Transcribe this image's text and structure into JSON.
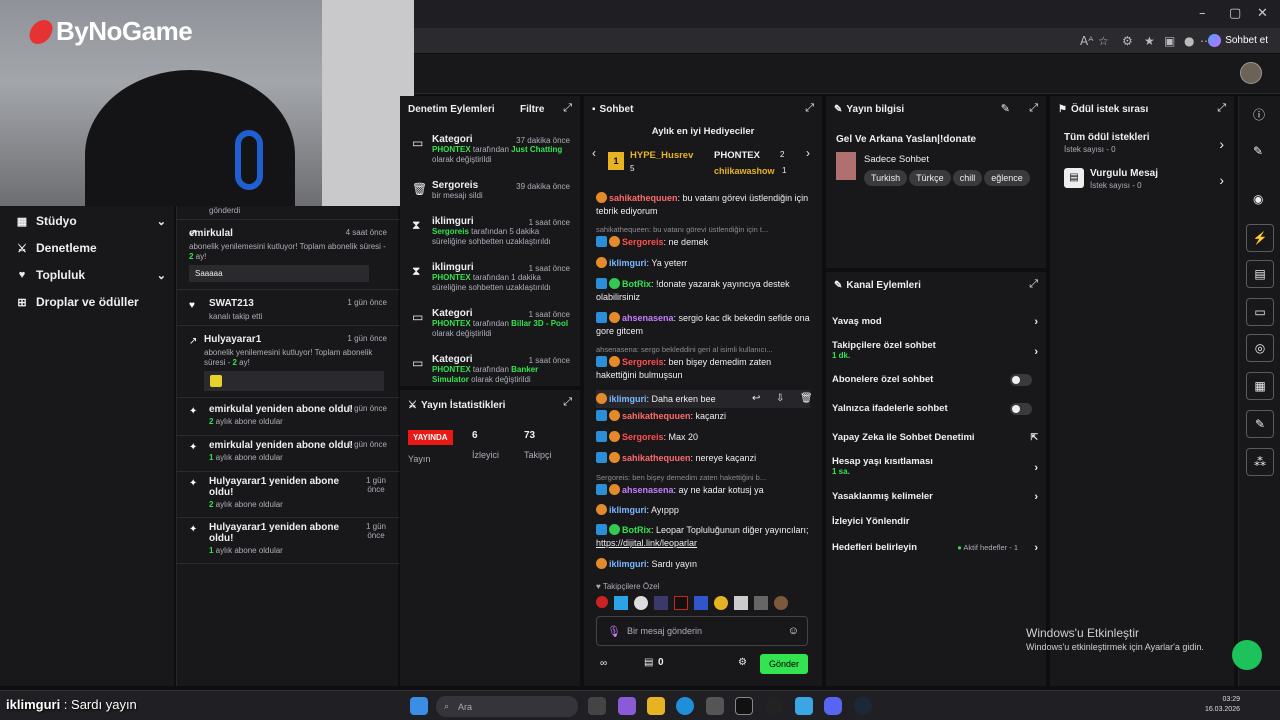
{
  "browser": {
    "sohbet_et": "Sohbet et",
    "reader": "Aᴬ"
  },
  "webcam": {
    "logo": "ByNoGame"
  },
  "leftnav": {
    "items": [
      {
        "label": "Stüdyo"
      },
      {
        "label": "Denetleme"
      },
      {
        "label": "Topluluk"
      },
      {
        "label": "Droplar ve ödüller"
      }
    ]
  },
  "activity": {
    "top_fragment": "gönderdi",
    "items": [
      {
        "name": "emirkulal",
        "time": "4 saat önce",
        "sub": "abonelik yenilemesini kutluyor! Toplam abonelik süresi - ",
        "months": "2",
        "sub_end": " ay!",
        "msg": "Saaaaa"
      },
      {
        "name": "SWAT213",
        "time": "1 gün önce",
        "sub": "kanalı takip etti"
      },
      {
        "name": "Hulyayarar1",
        "time": "1 gün önce",
        "sub": "abonelik yenilemesini kutluyor! Toplam abonelik süresi - ",
        "months": "2",
        "sub_end": " ay!"
      },
      {
        "name": "emirkulal yeniden abone oldu!",
        "time": "1 gün önce",
        "months": "2",
        "sub": " aylık abone oldular"
      },
      {
        "name": "emirkulal yeniden abone oldu!",
        "time": "1 gün önce",
        "months": "1",
        "sub": " aylık abone oldular"
      },
      {
        "name": "Hulyayarar1 yeniden abone oldu!",
        "time": "1 gün önce",
        "months": "2",
        "sub": " aylık abone oldular"
      },
      {
        "name": "Hulyayarar1 yeniden abone oldu!",
        "time": "1 gün önce",
        "months": "1",
        "sub": " aylık abone oldular"
      }
    ]
  },
  "modactions": {
    "title": "Denetim Eylemleri",
    "filter": "Filtre",
    "items": [
      {
        "title": "Kategori",
        "time": "37 dakika önce",
        "who": "PHONTEX",
        "mid": " tarafından ",
        "what": "Just Chatting",
        "end": " olarak değiştirildi"
      },
      {
        "title": "Sergoreis",
        "time": "39 dakika önce",
        "end": "bir mesajı sildi"
      },
      {
        "title": "iklimguri",
        "time": "1 saat önce",
        "who": "Sergoreis",
        "mid": " tarafından 5 dakika süreliğine sohbetten uzaklaştırıldı"
      },
      {
        "title": "iklimguri",
        "time": "1 saat önce",
        "who": "PHONTEX",
        "mid": " tarafından 1 dakika süreliğine sohbetten uzaklaştırıldı"
      },
      {
        "title": "Kategori",
        "time": "1 saat önce",
        "who": "PHONTEX",
        "mid": " tarafından ",
        "what": "Billar 3D - Pool",
        "end": " olarak değiştirildi"
      },
      {
        "title": "Kategori",
        "time": "1 saat önce",
        "who": "PHONTEX",
        "mid": " tarafından ",
        "what": "Banker Simulator",
        "end": " olarak değiştirildi"
      }
    ]
  },
  "stats": {
    "title": "Yayın İstatistikleri",
    "live": "YAYINDA",
    "live_label": "Yayın",
    "viewers": "6",
    "viewers_label": "İzleyici",
    "followers": "73",
    "followers_label": "Takipçi"
  },
  "chat": {
    "title": "Sohbet",
    "gifters_title": "Aylık en iyi Hediyeciler",
    "gifter1": {
      "rank": "1",
      "name": "HYPE_Husrev",
      "count": "5"
    },
    "gifter2": {
      "name": "PHONTEX",
      "count": "2"
    },
    "gifter3": {
      "name": "chiikawashow",
      "count": "1"
    },
    "lines": [
      {
        "user": "sahikathequuen",
        "color": "#ff6b6b",
        "text": " bu vatanı görevi üstlendiğin için tebrik ediyorum"
      },
      {
        "reply": "sahikathequeen: bu vatanı görevi üstlendiğin için t..."
      },
      {
        "user": "Sergoreis",
        "color": "#ff4f4f",
        "text": " ne demek"
      },
      {
        "user": "iklimguri",
        "color": "#7ab8ff",
        "text": " Ya yeterr"
      },
      {
        "user": "BotRix",
        "color": "#33e34f",
        "text": " !donate yazarak yayıncıya destek olabilirsiniz"
      },
      {
        "user": "ahsenasena",
        "color": "#c77dff",
        "text": " sergio kac dk bekedin sefide ona gore gitcem"
      },
      {
        "reply": "ahsenasena: sergo bekleddini geri al isimli kullanıcı..."
      },
      {
        "user": "Sergoreis",
        "color": "#ff4f4f",
        "text": " ben bişey demedim zaten hakettiğini bulmuşsun"
      },
      {
        "user": "iklimguri",
        "color": "#7ab8ff",
        "text": " Daha erken bee"
      },
      {
        "user": "sahikathequuen",
        "color": "#ff6b6b",
        "text": " kaçanzi"
      },
      {
        "user": "Sergoreis",
        "color": "#ff4f4f",
        "text": " Max 20"
      },
      {
        "user": "sahikathequuen",
        "color": "#ff6b6b",
        "text": " nereye kaçanzi"
      },
      {
        "reply": "Sergoreis: ben bişey demedim zaten hakettiğini b..."
      },
      {
        "user": "ahsenasena",
        "color": "#c77dff",
        "text": " ay ne kadar kotusj ya"
      },
      {
        "user": "iklimguri",
        "color": "#7ab8ff",
        "text": " Ayıppp"
      },
      {
        "user": "BotRix",
        "color": "#33e34f",
        "text": " Leopar Topluluğunun diğer yayıncıları; ",
        "link": "https://dijital.link/leoparlar"
      },
      {
        "user": "iklimguri",
        "color": "#7ab8ff",
        "text": " Sardı yayın"
      }
    ],
    "followers_only": "Takipçilere Özel",
    "placeholder": "Bir mesaj gönderin",
    "points": "0",
    "send": "Gönder"
  },
  "streaminfo": {
    "title": "Yayın bilgisi",
    "stream_title": "Gel Ve Arkana Yaslan|!donate",
    "category": "Sadece Sohbet",
    "tags": [
      "Turkish",
      "Türkçe",
      "chill",
      "eğlence"
    ]
  },
  "channelactions": {
    "title": "Kanal Eylemleri",
    "items": [
      {
        "label": "Yavaş mod"
      },
      {
        "label": "Takipçilere özel sohbet",
        "sub": "1 dk."
      },
      {
        "label": "Abonelere özel sohbet"
      },
      {
        "label": "Yalnızca ifadelerle sohbet"
      },
      {
        "label": "Yapay Zeka ile Sohbet Denetimi"
      },
      {
        "label": "Hesap yaşı kısıtlaması",
        "sub": "1 sa."
      },
      {
        "label": "Yasaklanmış kelimeler"
      },
      {
        "label": "İzleyici Yönlendir"
      },
      {
        "label": "Hedefleri belirleyin",
        "note": "Aktif hedefler - 1"
      }
    ]
  },
  "rewards": {
    "title": "Ödül istek sırası",
    "all": "Tüm ödül istekleri",
    "all_count": "İstek sayısı - 0",
    "highlight": "Vurgulu Mesaj",
    "highlight_count": "İstek sayısı - 0"
  },
  "activation": {
    "line1": "Windows'u Etkinleştir",
    "line2": "Windows'u etkinleştirmek için Ayarlar'a gidin."
  },
  "overlay": {
    "name": "iklimguri",
    "sep": " : ",
    "text": "Sardı yayın"
  },
  "taskbar": {
    "search": "Ara",
    "time": "03:29",
    "date": "16.03.2026"
  }
}
